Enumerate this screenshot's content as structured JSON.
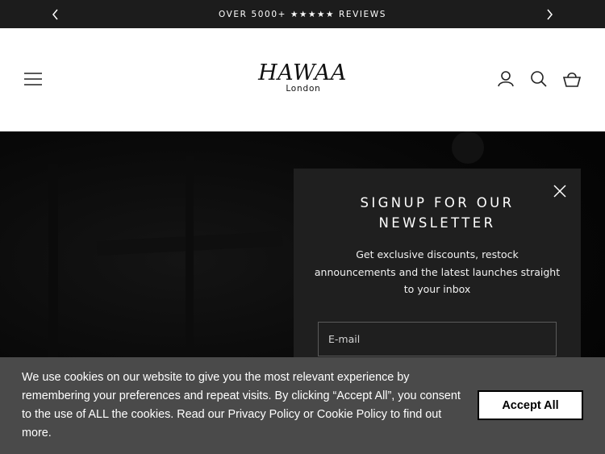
{
  "announcement": {
    "text": "OVER 5000+ ★★★★★ REVIEWS",
    "prev_icon": "chevron-left-icon",
    "next_icon": "chevron-right-icon"
  },
  "header": {
    "logo": {
      "brand": "HAWAA",
      "sub": "London"
    },
    "icons": [
      "menu-icon",
      "account-icon",
      "search-icon",
      "cart-icon"
    ]
  },
  "newsletter": {
    "title_line1": "SIGNUP FOR OUR",
    "title_line2": "NEWSLETTER",
    "desc_line1": "Get exclusive discounts, restock",
    "desc_line2": "announcements and the latest launches straight",
    "desc_line3": "to your inbox",
    "email_placeholder": "E-mail"
  },
  "cookie_banner": {
    "line1": "We use cookies on our website to give you the most relevant experience by",
    "line2": "remembering your preferences and repeat visits. By clicking “Accept All”, you consent",
    "line3": "to the use of ALL the cookies. Read our Privacy Policy or Cookie Policy to find out",
    "line4": "more.",
    "accept_label": "Accept All"
  },
  "colors": {
    "announcement_bg": "#1c1c1c",
    "header_bg": "#ffffff",
    "popup_bg": "#1f1f1f",
    "cookie_bg": "#4a4a4a",
    "button_bg": "#ffffff"
  }
}
